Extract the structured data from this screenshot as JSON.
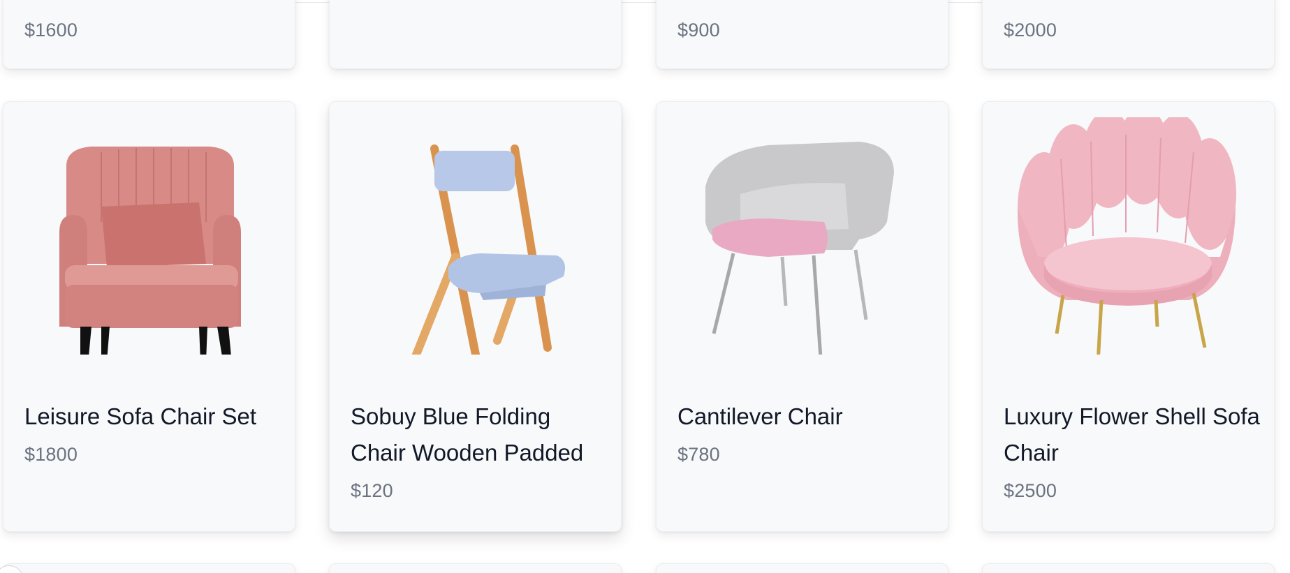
{
  "top_row": [
    {
      "price": "$1600"
    },
    {
      "price": ""
    },
    {
      "price": "$900"
    },
    {
      "price": "$2000"
    }
  ],
  "products": [
    {
      "title": "Leisure Sofa Chair Set",
      "price": "$1800",
      "icon": "pink-wingback-armchair-image"
    },
    {
      "title": "Sobuy Blue Folding Chair Wooden Padded",
      "price": "$120",
      "icon": "blue-folding-wooden-chair-image"
    },
    {
      "title": "Cantilever Chair",
      "price": "$780",
      "icon": "grey-pink-metal-leg-chair-image"
    },
    {
      "title": "Luxury Flower Shell Sofa Chair",
      "price": "$2500",
      "icon": "pink-shell-sofa-chair-image"
    }
  ],
  "colors": {
    "card_bg": "#f8f9fa",
    "title_text": "#111827",
    "price_text": "#6b7280"
  }
}
